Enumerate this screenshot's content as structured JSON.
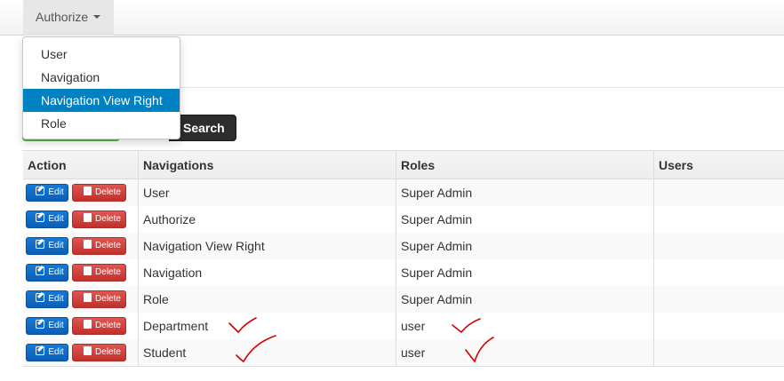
{
  "navbar": {
    "menu_label": "Authorize",
    "dropdown_items": [
      {
        "label": "User"
      },
      {
        "label": "Navigation"
      },
      {
        "label": "Navigation View Right"
      },
      {
        "label": "Role"
      }
    ]
  },
  "search": {
    "button_label": "Search"
  },
  "table": {
    "headers": [
      "Action",
      "Navigations",
      "Roles",
      "Users"
    ],
    "edit_label": "Edit",
    "delete_label": "Delete",
    "rows": [
      {
        "navigation": "User",
        "role": "Super Admin",
        "user": ""
      },
      {
        "navigation": "Authorize",
        "role": "Super Admin",
        "user": ""
      },
      {
        "navigation": "Navigation View Right",
        "role": "Super Admin",
        "user": ""
      },
      {
        "navigation": "Navigation",
        "role": "Super Admin",
        "user": ""
      },
      {
        "navigation": "Role",
        "role": "Super Admin",
        "user": ""
      },
      {
        "navigation": "Department",
        "role": "user",
        "user": ""
      },
      {
        "navigation": "Student",
        "role": "user",
        "user": ""
      }
    ]
  },
  "colors": {
    "active_item": "#0081c2",
    "edit_button": "#0a5fb8",
    "delete_button": "#c3302b",
    "search_button": "#2d2d2d",
    "annotation": "#d40000"
  },
  "annotations": {
    "icon": "red-checkmark-icon"
  }
}
